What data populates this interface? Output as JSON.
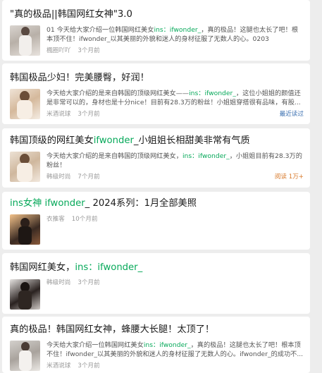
{
  "articles": [
    {
      "title": "\"真的极品||韩国网红女神\"3.0",
      "excerpt_a": "01 今天给大家介绍一位韩国网红美女",
      "excerpt_hl": "ins：ifwonder_",
      "excerpt_b": "，真的极品！这腿也太长了吧！根本顶不住！ifwonder_以其美丽的外貌和迷人的身材征服了无数人的心。0203",
      "source": "楓圈吖吖",
      "time": "3个月前",
      "right_label": ""
    },
    {
      "title": "韩国极品少妇！完美腰臀，好润！",
      "excerpt_a": "今天给大家介绍的是来自韩国的顶级网红美女——",
      "excerpt_hl": "ins：ifwonder_",
      "excerpt_b": "，这位小姐姐的颜值还是非常可以的，身材也是十分nice！目前有28.3万的粉丝！小姐姐穿搭很有品味，有股...",
      "source": "米酒说球",
      "time": "3个月前",
      "right_label": "最近读过"
    },
    {
      "title_a": "韩国顶级的网红美女",
      "title_hl": "ifwonder",
      "title_b": "_小姐姐长相甜美非常有气质",
      "excerpt_a": "今天给大家介绍的是来自韩国的顶级网红美女，",
      "excerpt_hl": "ins：ifwonder_",
      "excerpt_b": "，小姐姐目前有28.3万的粉丝！",
      "source": "韩级时尚",
      "time": "7个月前",
      "right_label": "阅读 1万+"
    },
    {
      "title_hl": "ins女神 ifwonder",
      "title_b": "_ 2024系列：1月全部美照",
      "source": "衣推客",
      "time": "10个月前"
    },
    {
      "title_a": "韩国网红美女，",
      "title_hl": "ins：ifwonder_",
      "source": "韩级时尚",
      "time": "3个月前"
    },
    {
      "title": "真的极品！韩国网红女神，蜂腰大长腿！太顶了！",
      "excerpt_a": "今天给大家介绍一位韩国网红美女",
      "excerpt_hl": "ins：ifwonder_",
      "excerpt_b": "，真的极品！这腿也太长了吧！根本顶不住！ifwonder_以其美丽的外貌和迷人的身材征服了无数人的心。ifwonder_的成功不...",
      "source": "米酒说球",
      "time": "3个月前",
      "right_label": ""
    }
  ],
  "colors": {
    "highlight": "#07a95a",
    "read_label": "#3a6fb0",
    "views_label": "#d8792a"
  }
}
